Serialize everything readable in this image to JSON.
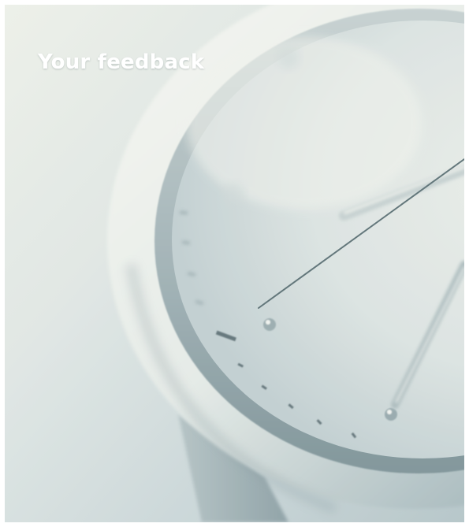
{
  "header": {
    "title": "Your feedback"
  },
  "hero_image": {
    "subject": "watch-face-closeup-image"
  },
  "colors": {
    "background_light": "#eef1ec",
    "tint": "#b9c9cc",
    "metal_dark": "#7f9297",
    "title_text": "#ffffff"
  }
}
